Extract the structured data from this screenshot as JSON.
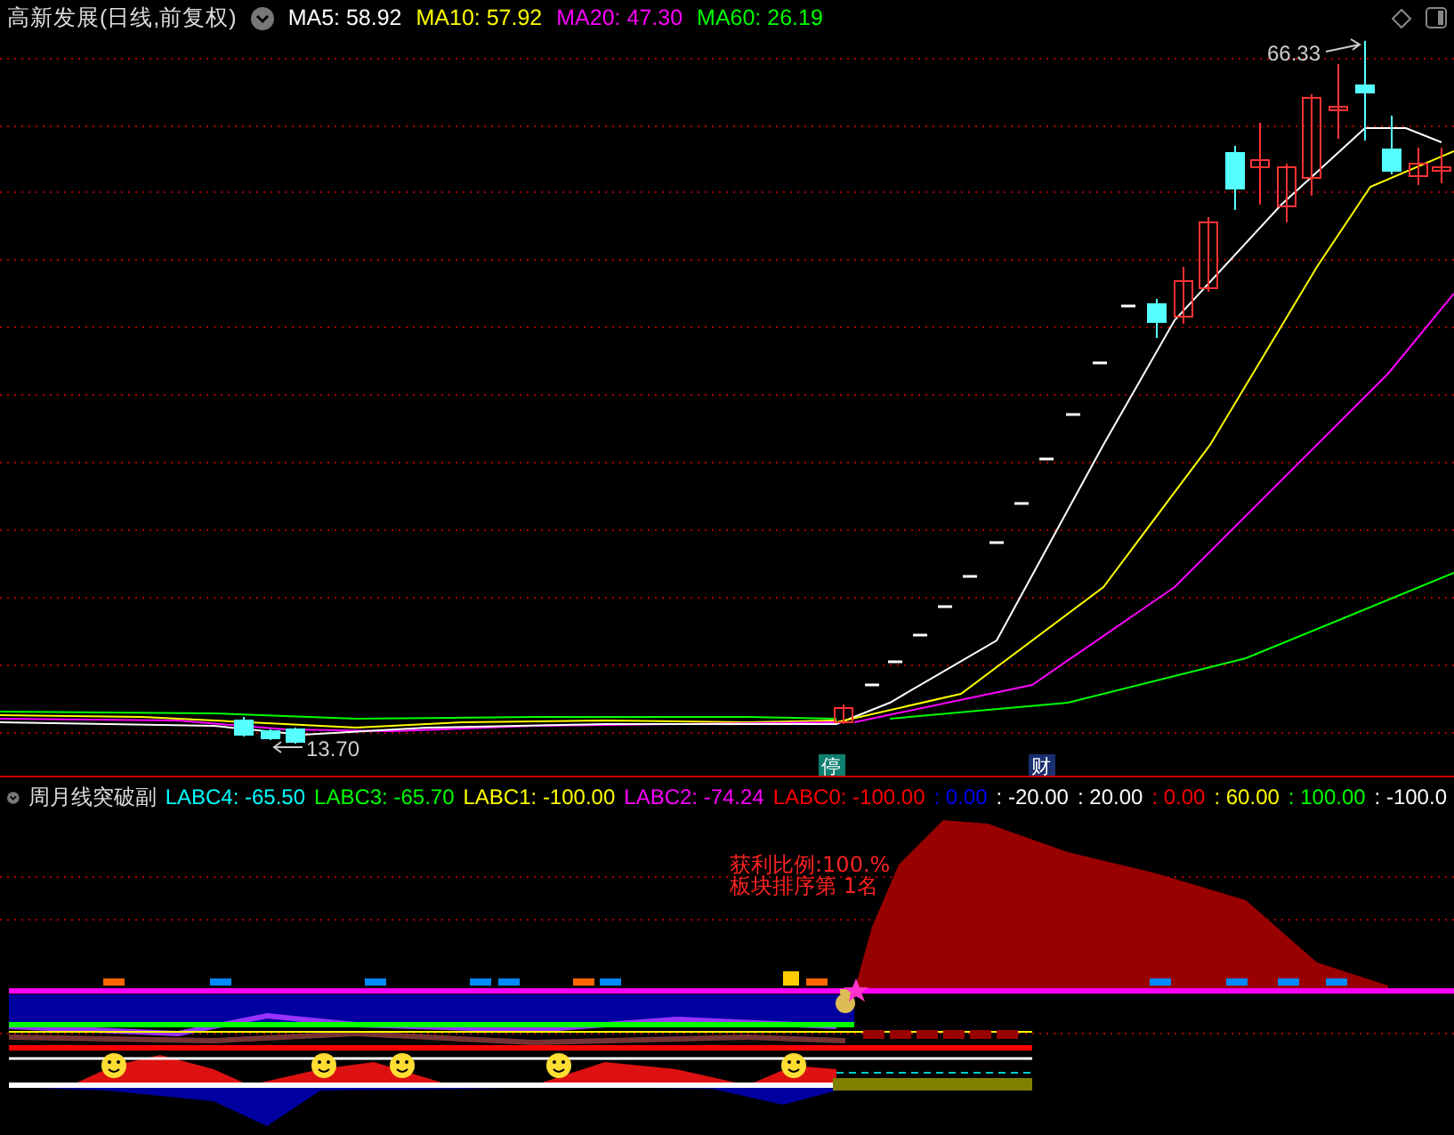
{
  "main_panel": {
    "title": "高新发展(日线,前复权)",
    "indicators": [
      {
        "label": "MA5: 58.92",
        "color": "#ffffff"
      },
      {
        "label": "MA10: 57.92",
        "color": "#ffff00"
      },
      {
        "label": "MA20: 47.30",
        "color": "#ff00ff"
      },
      {
        "label": "MA60: 26.19",
        "color": "#00ff00"
      }
    ],
    "high_label": "66.33",
    "low_label": "13.70",
    "event_markers": [
      {
        "label": "停",
        "color": "#0f7f6f"
      },
      {
        "label": "财",
        "color": "#1a2f6f"
      }
    ]
  },
  "sub_panel": {
    "title": "周月线突破副",
    "indicators": [
      {
        "label": "LABC4: -65.50",
        "color": "#00ffff"
      },
      {
        "label": "LABC3: -65.70",
        "color": "#00ff00"
      },
      {
        "label": "LABC1: -100.00",
        "color": "#ffff00"
      },
      {
        "label": "LABC2: -74.24",
        "color": "#ff00ff"
      },
      {
        "label": "LABC0: -100.00",
        "color": "#ff0000"
      },
      {
        "label": ": 0.00",
        "color": "#0000ff"
      },
      {
        "label": ": -20.00",
        "color": "#ffffff"
      },
      {
        "label": ": 20.00",
        "color": "#ffffff"
      },
      {
        "label": ": 0.00",
        "color": "#ff0000"
      },
      {
        "label": ": 60.00",
        "color": "#ffff00"
      },
      {
        "label": ": 100.00",
        "color": "#00ff00"
      },
      {
        "label": ": -100.0",
        "color": "#ffffff"
      }
    ],
    "notes": [
      "获利比例:100.%",
      "板块排序第 1名"
    ]
  }
}
